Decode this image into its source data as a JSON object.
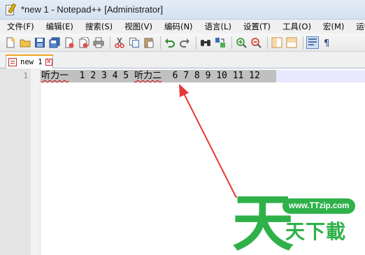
{
  "window": {
    "title": "*new 1 - Notepad++ [Administrator]"
  },
  "menu": {
    "items": [
      {
        "label": "文件(F)"
      },
      {
        "label": "编辑(E)"
      },
      {
        "label": "搜索(S)"
      },
      {
        "label": "视图(V)"
      },
      {
        "label": "编码(N)"
      },
      {
        "label": "语言(L)"
      },
      {
        "label": "设置(T)"
      },
      {
        "label": "工具(O)"
      },
      {
        "label": "宏(M)"
      },
      {
        "label": "运行(R"
      }
    ]
  },
  "toolbar": {
    "icons": [
      "new-file-icon",
      "open-file-icon",
      "save-icon",
      "save-all-icon",
      "close-icon",
      "close-all-icon",
      "print-icon",
      "cut-icon",
      "copy-icon",
      "paste-icon",
      "undo-icon",
      "redo-icon",
      "find-icon",
      "replace-icon",
      "zoom-in-icon",
      "zoom-out-icon",
      "sync-vertical-icon",
      "sync-horizontal-icon",
      "word-wrap-icon",
      "show-all-characters-icon"
    ]
  },
  "tabs": [
    {
      "label": "new 1",
      "close_glyph": "✕"
    }
  ],
  "editor": {
    "lines": [
      {
        "number": "1",
        "segments": [
          "听力一",
          "  1 2 3 4 5 ",
          "听力二",
          "  6 7 8 9 10 11 12"
        ]
      }
    ]
  },
  "watermark": {
    "big_char": "天",
    "url": "www.TTzip.com",
    "chars": "天下載"
  },
  "colors": {
    "accent_tab": "#f5a623",
    "arrow": "#e53935",
    "watermark_green": "#2fb14a",
    "selection": "#c0c0c0",
    "current_line": "#e8e8ff"
  }
}
